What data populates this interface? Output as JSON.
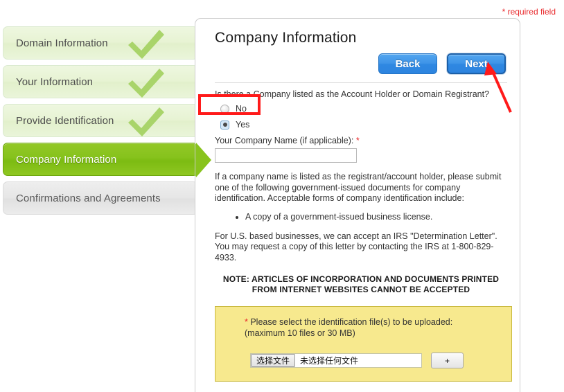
{
  "required_note": "* required field",
  "sidebar": {
    "steps": [
      {
        "label": "Domain Information",
        "state": "done",
        "icon": "check-icon"
      },
      {
        "label": "Your Information",
        "state": "done",
        "icon": "check-icon"
      },
      {
        "label": "Provide Identification",
        "state": "done",
        "icon": "check-icon"
      },
      {
        "label": "Company Information",
        "state": "current",
        "icon": ""
      },
      {
        "label": "Confirmations and Agreements",
        "state": "pending",
        "icon": ""
      }
    ]
  },
  "panel": {
    "title": "Company Information",
    "buttons": {
      "back": "Back",
      "next": "Next"
    },
    "question": "Is there a Company listed as the Account Holder or Domain Registrant?",
    "options": [
      {
        "label": "No",
        "selected": false
      },
      {
        "label": "Yes",
        "selected": true
      }
    ],
    "company_name": {
      "label": "Your Company Name (if applicable): ",
      "required_marker": "*",
      "value": "",
      "placeholder": ""
    },
    "paragraph_1": "If a company name is listed as the registrant/account holder, please submit one of the following government-issued documents for company identification. Acceptable forms of company identification include:",
    "bullets": [
      "A copy of a government-issued business license."
    ],
    "paragraph_2": "For U.S. based businesses, we can accept an IRS \"Determination Letter\". You may request a copy of this letter by contacting the IRS at 1-800-829-4933.",
    "note_line_1": "NOTE: ARTICLES OF INCORPORATION AND DOCUMENTS PRINTED",
    "note_line_2": "FROM INTERNET WEBSITES CANNOT BE ACCEPTED",
    "upload": {
      "required_marker": "*",
      "instruction_line_1": " Please select the identification file(s) to be uploaded:",
      "instruction_line_2": "(maximum 10 files or 30 MB)",
      "choose_file_button": "选择文件",
      "file_status": "未选择任何文件",
      "add_button": "+"
    }
  },
  "colors": {
    "required_red": "#e8282b",
    "annotation_red": "#ff1a1a",
    "step_current_green": "#88c31d",
    "step_done_green": "#e4f1d0",
    "button_blue": "#2f88e2",
    "upload_yellow": "#f7e98e",
    "upload_border": "#c9b93e"
  }
}
